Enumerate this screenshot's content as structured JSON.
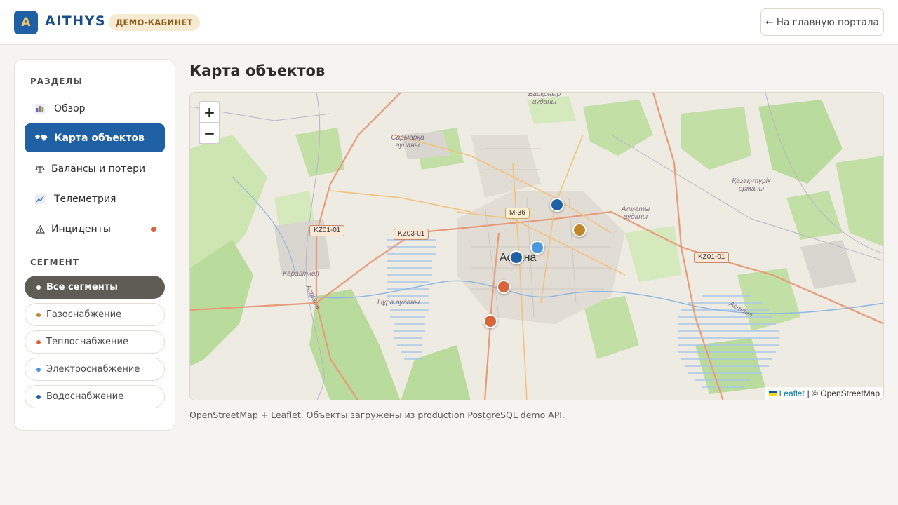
{
  "header": {
    "logo_letter": "A",
    "brand": "AITHYS",
    "badge": "ДЕМО-КАБИНЕТ",
    "portal_button": "← На главную портала"
  },
  "sidebar": {
    "sections_title": "РАЗДЕЛЫ",
    "items": [
      {
        "label": "Обзор",
        "icon": "bar-chart-icon",
        "active": false
      },
      {
        "label": "Карта объектов",
        "icon": "world-map-icon",
        "active": true
      },
      {
        "label": "Балансы и потери",
        "icon": "scales-icon",
        "active": false
      },
      {
        "label": "Телеметрия",
        "icon": "line-chart-icon",
        "active": false
      },
      {
        "label": "Инциденты",
        "icon": "warning-icon",
        "active": false,
        "has_alert": true
      }
    ],
    "segment_title": "СЕГМЕНТ",
    "segments": [
      {
        "label": "Все сегменты",
        "color": "#ffffff",
        "active": true
      },
      {
        "label": "Газоснабжение",
        "color": "#c0862c",
        "active": false
      },
      {
        "label": "Теплоснабжение",
        "color": "#d8643c",
        "active": false
      },
      {
        "label": "Электроснабжение",
        "color": "#4a98dc",
        "active": false
      },
      {
        "label": "Водоснабжение",
        "color": "#1f5fa3",
        "active": false
      }
    ]
  },
  "main": {
    "title": "Карта объектов",
    "note": "OpenStreetMap + Leaflet. Объекты загружены из production PostgreSQL demo API."
  },
  "map": {
    "zoom_in": "+",
    "zoom_out": "−",
    "attribution_leaflet": "Leaflet",
    "attribution_rest": "| © OpenStreetMap",
    "city": "Астана",
    "road_labels": [
      "KZ01-01",
      "KZ03-01",
      "M-36",
      "KZ01-01"
    ],
    "place_labels": [
      "Байқоңыр ауданы",
      "Сарыарқа ауданы",
      "Алматы ауданы",
      "Қазақ-түрік орманы",
      "Нұра ауданы",
      "Каравткел",
      "Астана",
      "Астана"
    ],
    "marker_colors": {
      "water": "#1f5fa3",
      "gas": "#c0862c",
      "heat": "#d8643c",
      "electric": "#4a98dc"
    }
  }
}
